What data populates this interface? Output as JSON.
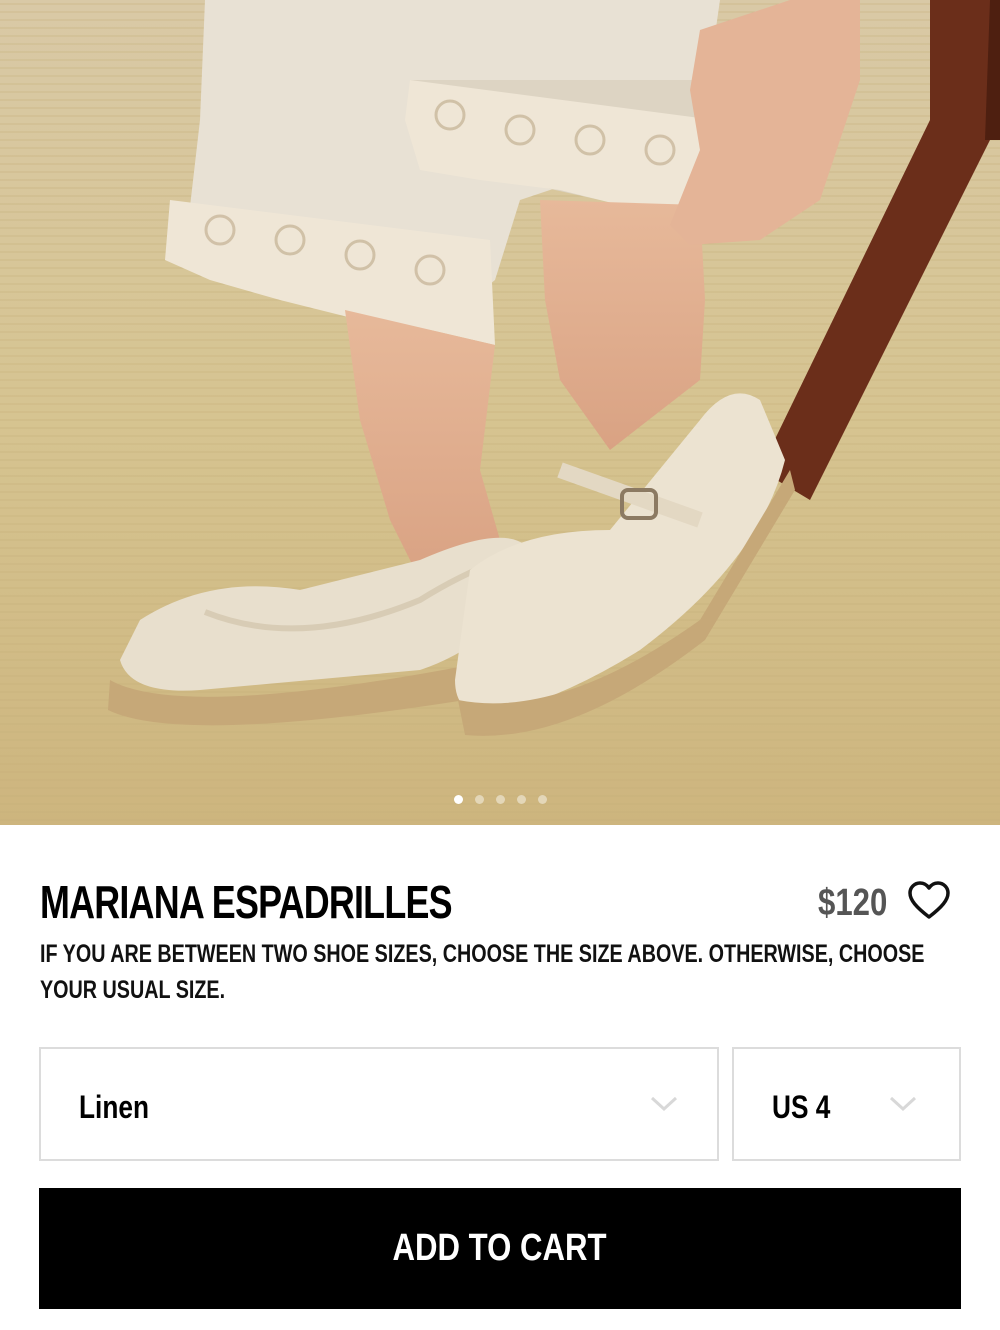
{
  "carousel": {
    "slide_count": 5,
    "active_index": 0
  },
  "product": {
    "title": "MARIANA ESPADRILLES",
    "price": "$120",
    "size_note": "IF YOU ARE BETWEEN TWO SHOE SIZES, CHOOSE THE SIZE ABOVE. OTHERWISE, CHOOSE YOUR USUAL SIZE."
  },
  "selectors": {
    "color": {
      "value": "Linen",
      "icon": "chevron-down-icon"
    },
    "size": {
      "value": "US 4",
      "icon": "chevron-down-icon"
    }
  },
  "actions": {
    "add_to_cart": "ADD TO CART",
    "favorite_icon": "heart-outline-icon"
  },
  "colors": {
    "button_bg": "#000000",
    "button_text": "#ffffff",
    "border": "#dcdcdc",
    "price": "#555555"
  }
}
